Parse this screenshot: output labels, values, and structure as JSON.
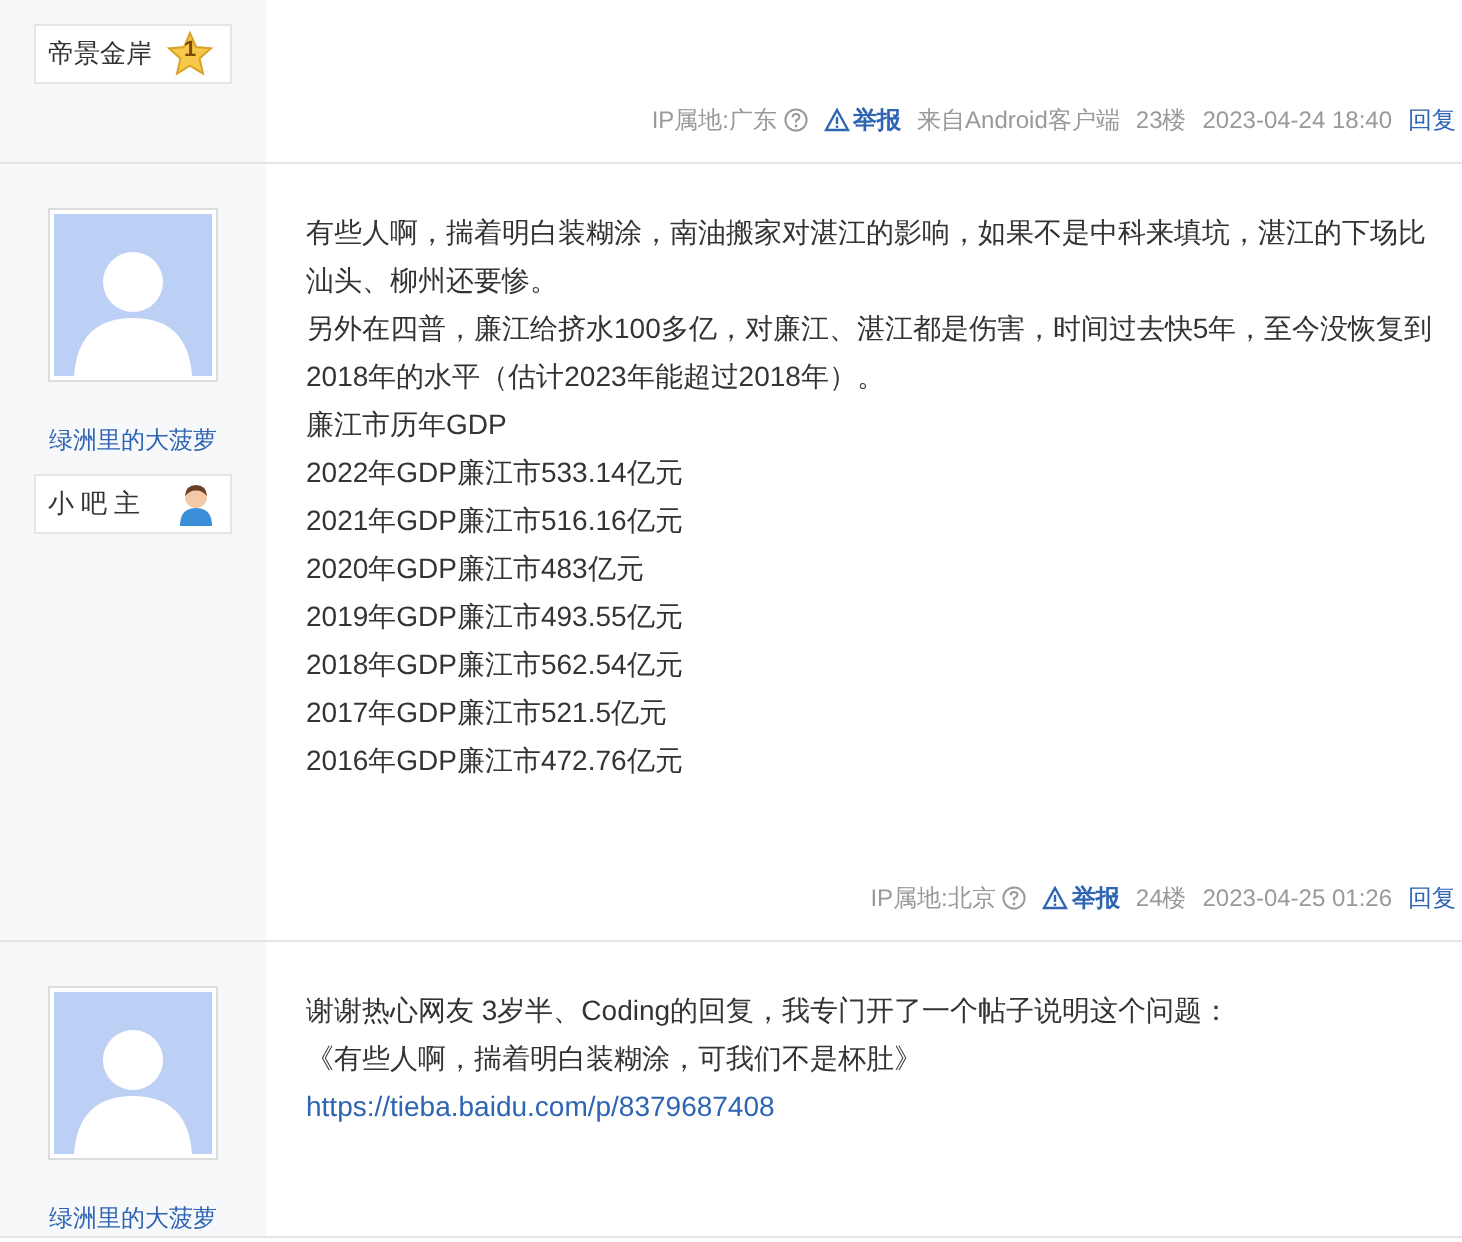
{
  "posts": [
    {
      "badge": {
        "kind": "level",
        "label": "帝景金岸",
        "level_text": "1"
      },
      "footer": {
        "ip": "IP属地:广东",
        "report": "举报",
        "source_prefix": "来自",
        "source": "Android客户端",
        "floor": "23楼",
        "time": "2023-04-24 18:40",
        "reply": "回复"
      }
    },
    {
      "author": "绿洲里的大菠萝",
      "badge": {
        "kind": "manager",
        "label": "小 吧 主"
      },
      "lines": [
        {
          "kind": "text",
          "text": "有些人啊，揣着明白装糊涂，南油搬家对湛江的影响，如果不是中科来填坑，湛江的下场比汕头、柳州还要惨。"
        },
        {
          "kind": "text",
          "text": "另外在四普，廉江给挤水100多亿，对廉江、湛江都是伤害，时间过去快5年，至今没恢复到2018年的水平（估计2023年能超过2018年）。"
        },
        {
          "kind": "text",
          "text": "廉江市历年GDP"
        },
        {
          "kind": "text",
          "text": "2022年GDP廉江市533.14亿元"
        },
        {
          "kind": "text",
          "text": "2021年GDP廉江市516.16亿元"
        },
        {
          "kind": "text",
          "text": "2020年GDP廉江市483亿元"
        },
        {
          "kind": "text",
          "text": "2019年GDP廉江市493.55亿元"
        },
        {
          "kind": "text",
          "text": "2018年GDP廉江市562.54亿元"
        },
        {
          "kind": "text",
          "text": "2017年GDP廉江市521.5亿元"
        },
        {
          "kind": "text",
          "text": "2016年GDP廉江市472.76亿元"
        }
      ],
      "footer": {
        "ip": "IP属地:北京",
        "report": "举报",
        "floor": "24楼",
        "time": "2023-04-25 01:26",
        "reply": "回复"
      }
    },
    {
      "author": "绿洲里的大菠萝",
      "lines": [
        {
          "kind": "text",
          "text": "谢谢热心网友 3岁半、Coding的回复，我专门开了一个帖子说明这个问题："
        },
        {
          "kind": "text",
          "text": "《有些人啊，揣着明白装糊涂，可我们不是杯肚》"
        },
        {
          "kind": "link",
          "text": "https://tieba.baidu.com/p/8379687408"
        }
      ]
    }
  ]
}
